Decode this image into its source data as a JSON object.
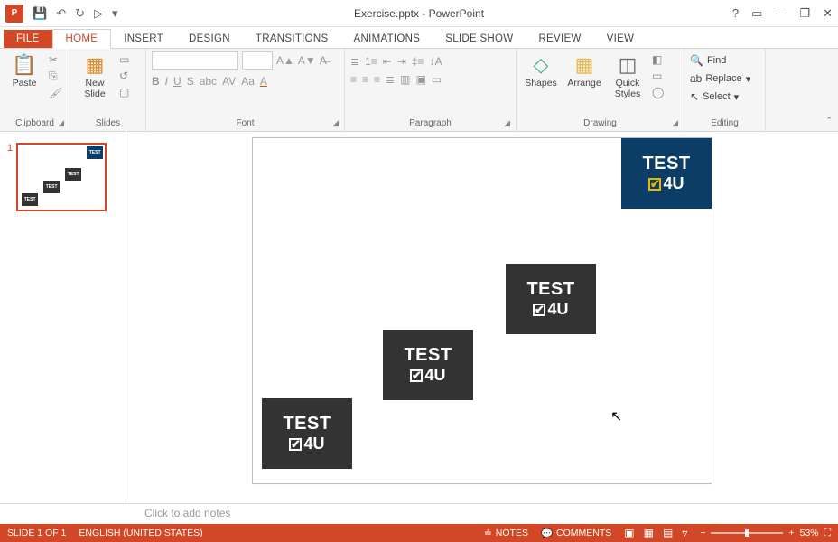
{
  "title": "Exercise.pptx - PowerPoint",
  "qat": {
    "save": "💾",
    "undo": "↶",
    "redo": "↻",
    "start": "▷",
    "more": "▾"
  },
  "winbtns": {
    "help": "?",
    "ribbon": "▭",
    "min": "—",
    "restore": "❐",
    "close": "✕"
  },
  "tabs": {
    "file": "FILE",
    "home": "HOME",
    "insert": "INSERT",
    "design": "DESIGN",
    "transitions": "TRANSITIONS",
    "animations": "ANIMATIONS",
    "slideshow": "SLIDE SHOW",
    "review": "REVIEW",
    "view": "VIEW"
  },
  "ribbon": {
    "clipboard": {
      "label": "Clipboard",
      "paste": "Paste",
      "cut": "✂",
      "copy": "⎘",
      "painter": "🖌"
    },
    "slides": {
      "label": "Slides",
      "newslide": "New\nSlide",
      "layout": "▭",
      "reset": "↺",
      "section": "▢"
    },
    "font": {
      "label": "Font"
    },
    "paragraph": {
      "label": "Paragraph"
    },
    "drawing": {
      "label": "Drawing",
      "shapes": "Shapes",
      "arrange": "Arrange",
      "quick": "Quick\nStyles"
    },
    "editing": {
      "label": "Editing",
      "find": "Find",
      "replace": "Replace",
      "select": "Select"
    }
  },
  "thumb": {
    "num": "1"
  },
  "logo": {
    "line1": "TEST",
    "line2": "4U"
  },
  "notes_placeholder": "Click to add notes",
  "status": {
    "slide": "SLIDE 1 OF 1",
    "lang": "ENGLISH (UNITED STATES)",
    "notes": "NOTES",
    "comments": "COMMENTS",
    "zoom": "53%"
  }
}
